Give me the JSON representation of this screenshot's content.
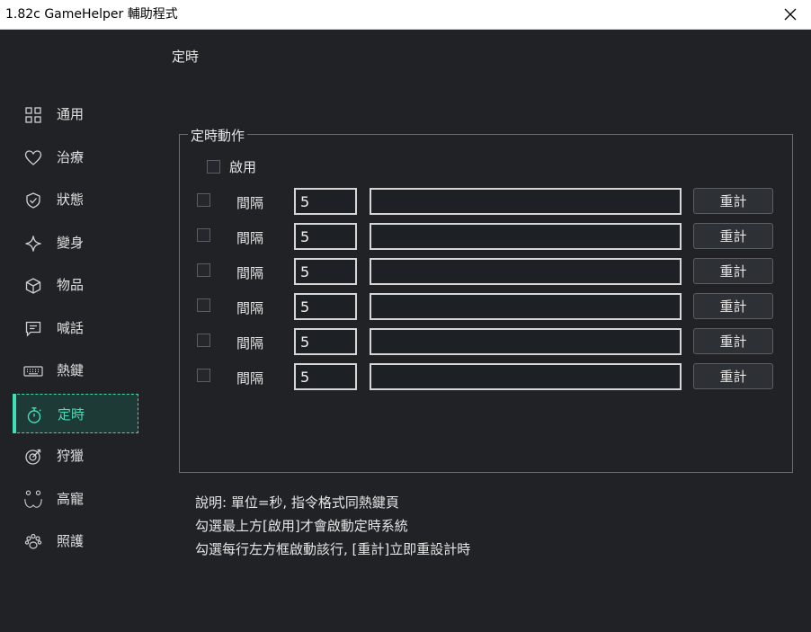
{
  "window": {
    "title": "1.82c GameHelper 輔助程式"
  },
  "page_title": "定時",
  "sidebar": {
    "items": [
      {
        "label": "通用",
        "icon": "grid-icon"
      },
      {
        "label": "治療",
        "icon": "heart-icon"
      },
      {
        "label": "狀態",
        "icon": "shield-icon"
      },
      {
        "label": "變身",
        "icon": "sparkle-icon"
      },
      {
        "label": "物品",
        "icon": "cube-icon"
      },
      {
        "label": "喊話",
        "icon": "chat-icon"
      },
      {
        "label": "熱鍵",
        "icon": "keyboard-icon"
      },
      {
        "label": "定時",
        "icon": "stopwatch-icon",
        "active": true
      },
      {
        "label": "狩獵",
        "icon": "target-icon"
      },
      {
        "label": "高寵",
        "icon": "pet-face-icon"
      },
      {
        "label": "照護",
        "icon": "paw-icon"
      }
    ]
  },
  "group": {
    "title": "定時動作",
    "enable_label": "啟用",
    "rows": [
      {
        "label": "間隔",
        "interval": "5",
        "command": "",
        "reset_label": "重計"
      },
      {
        "label": "間隔",
        "interval": "5",
        "command": "",
        "reset_label": "重計"
      },
      {
        "label": "間隔",
        "interval": "5",
        "command": "",
        "reset_label": "重計"
      },
      {
        "label": "間隔",
        "interval": "5",
        "command": "",
        "reset_label": "重計"
      },
      {
        "label": "間隔",
        "interval": "5",
        "command": "",
        "reset_label": "重計"
      },
      {
        "label": "間隔",
        "interval": "5",
        "command": "",
        "reset_label": "重計"
      }
    ]
  },
  "notes": [
    "說明: 單位=秒, 指令格式同熱鍵頁",
    "勾選最上方[啟用]才會啟動定時系統",
    "勾選每行左方框啟動該行, [重計]立即重設計時"
  ],
  "colors": {
    "accent": "#3fe0b8",
    "background": "#202225"
  }
}
